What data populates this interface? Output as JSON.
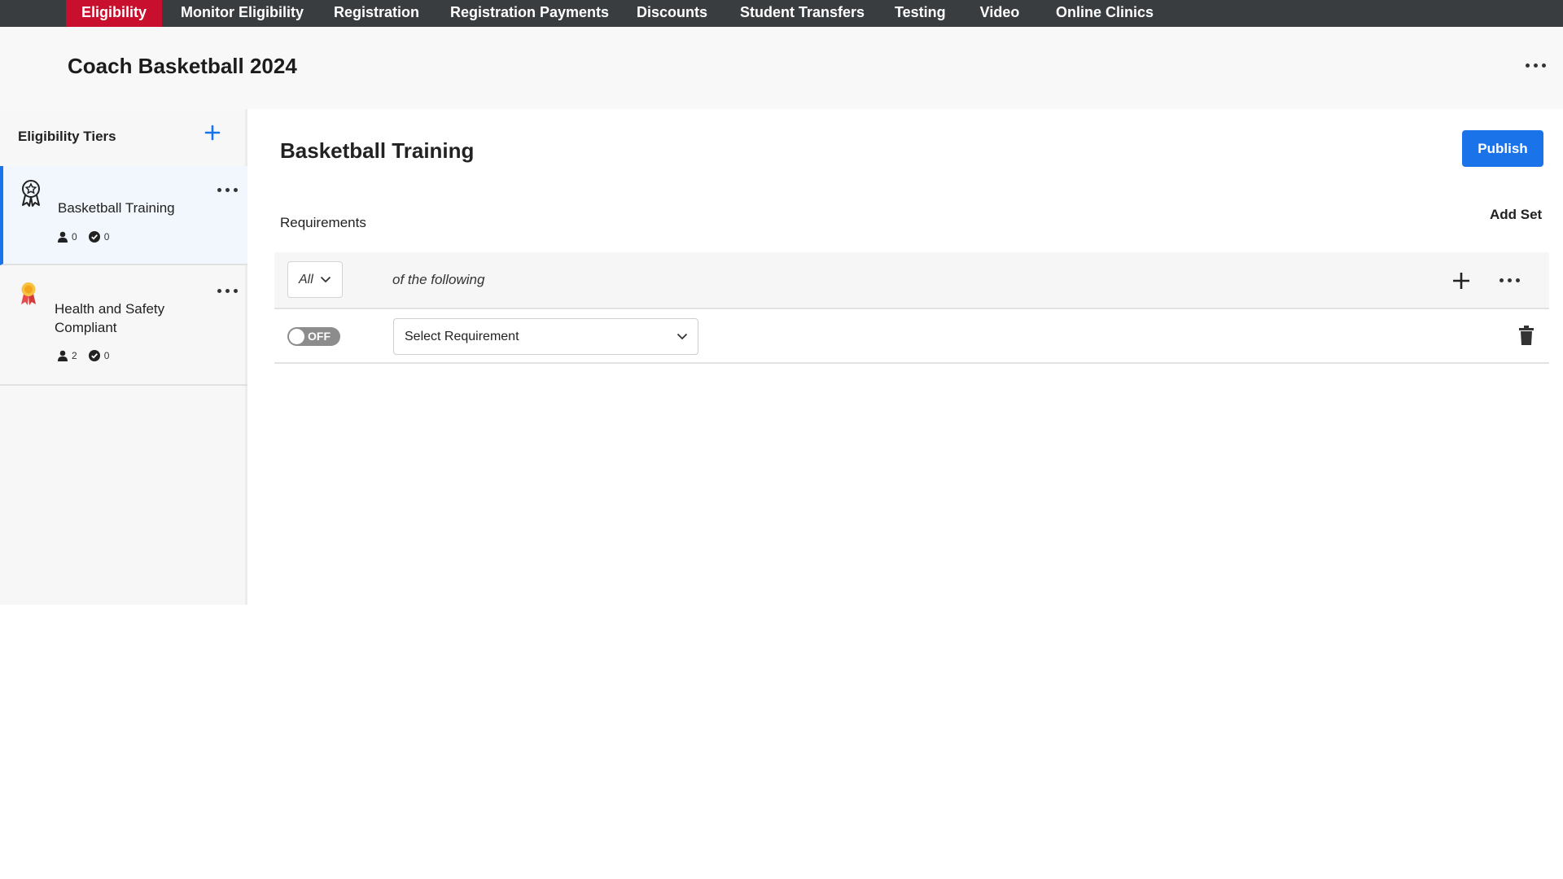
{
  "nav": {
    "tabs": [
      {
        "label": "Eligibility",
        "active": true
      },
      {
        "label": "Monitor Eligibility"
      },
      {
        "label": "Registration"
      },
      {
        "label": "Registration Payments"
      },
      {
        "label": "Discounts"
      },
      {
        "label": "Student Transfers"
      },
      {
        "label": "Testing"
      },
      {
        "label": "Video"
      },
      {
        "label": "Online Clinics"
      }
    ]
  },
  "header": {
    "title": "Coach Basketball 2024"
  },
  "sidebar": {
    "title": "Eligibility Tiers",
    "tiers": [
      {
        "name": "Basketball Training",
        "members": "0",
        "completed": "0",
        "icon": "award-ribbon-outline-icon",
        "active": true
      },
      {
        "name": "Health and Safety Compliant",
        "members": "2",
        "completed": "0",
        "icon": "award-ribbon-color-icon"
      }
    ]
  },
  "main": {
    "title": "Basketball Training",
    "publish_label": "Publish",
    "requirements_label": "Requirements",
    "add_set_label": "Add Set",
    "set": {
      "quantifier": "All",
      "of_following": "of the following",
      "requirement": {
        "toggle_label": "OFF",
        "toggle_on": false,
        "select_placeholder": "Select Requirement"
      }
    }
  },
  "colors": {
    "nav_bg": "#3a3d40",
    "nav_active": "#c8102e",
    "accent": "#1a73e8"
  }
}
